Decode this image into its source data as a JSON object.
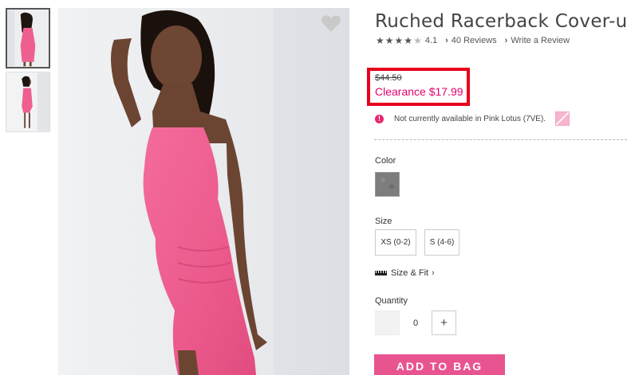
{
  "product": {
    "title": "Ruched Racerback Cover-up",
    "rating_value": "4.1",
    "reviews_link": "40 Reviews",
    "write_review_link": "Write a Review"
  },
  "price": {
    "original": "$44.50",
    "clearance": "Clearance $17.99"
  },
  "availability": {
    "message": "Not currently available in Pink Lotus (7VE)."
  },
  "color": {
    "label": "Color"
  },
  "size": {
    "label": "Size",
    "options": [
      "XS (0-2)",
      "S (4-6)"
    ]
  },
  "size_fit": {
    "label": "Size & Fit"
  },
  "quantity": {
    "label": "Quantity",
    "value": "0",
    "plus": "+"
  },
  "cta": {
    "add_to_bag": "ADD TO BAG"
  },
  "icons": {
    "alert": "!",
    "star": "★",
    "chevron": "›"
  },
  "colors": {
    "accent_pink": "#e8548f",
    "sale_red": "#e4006d",
    "highlight_red": "#e8001c"
  }
}
